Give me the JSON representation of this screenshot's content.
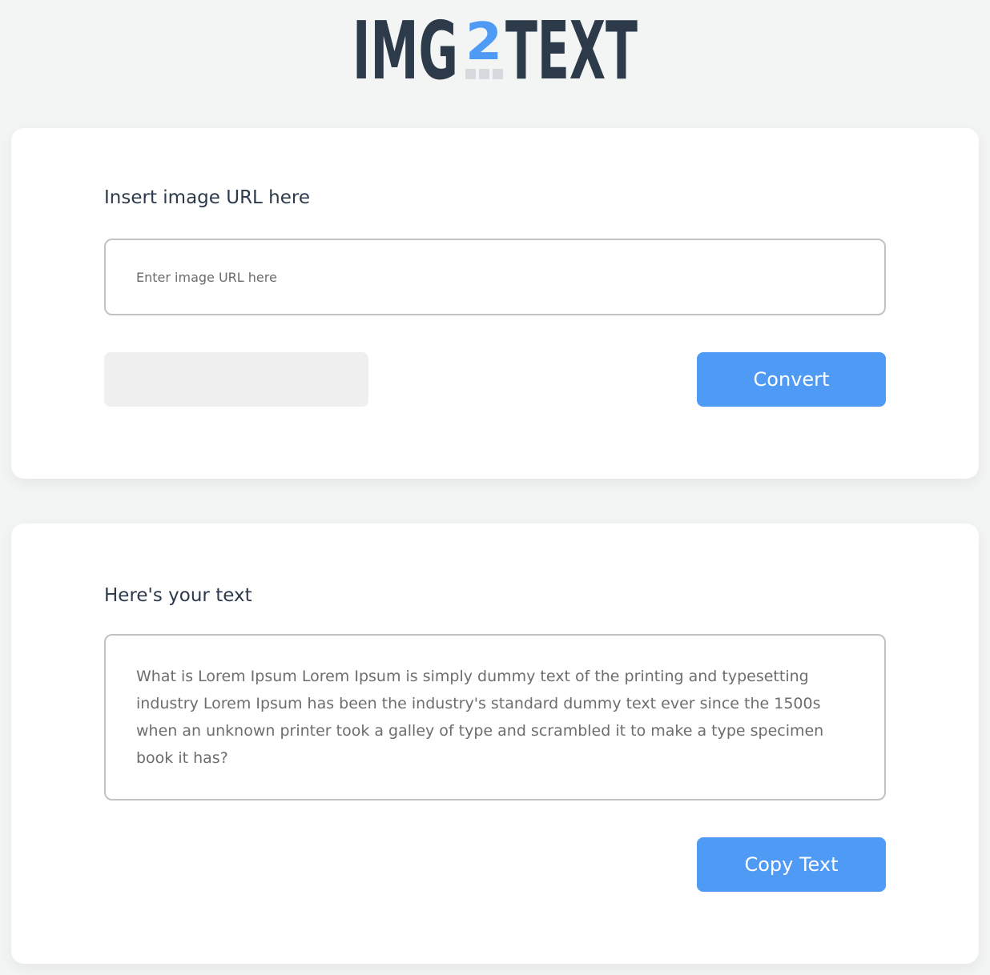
{
  "logo": {
    "text_left": "IMG",
    "text_middle": "2",
    "text_right": "TEXT",
    "dark_color": "#2d3a4a",
    "accent_color": "#4e9af5",
    "dots_color": "#d6d9dd"
  },
  "converter": {
    "title": "Insert image URL here",
    "url_placeholder": "Enter image URL here",
    "url_value": "",
    "convert_label": "Convert"
  },
  "result": {
    "title": "Here's your text",
    "text": "What is Lorem Ipsum Lorem Ipsum is simply dummy text of the printing and typesetting industry Lorem Ipsum has been the industry's standard dummy text ever since the 1500s when an unknown printer took a galley of type and scrambled it to make a type specimen book it has?",
    "copy_label": "Copy Text"
  },
  "colors": {
    "background": "#f3f5f5",
    "card": "#ffffff",
    "button": "#4e9af5",
    "border": "#c2c2c2"
  }
}
